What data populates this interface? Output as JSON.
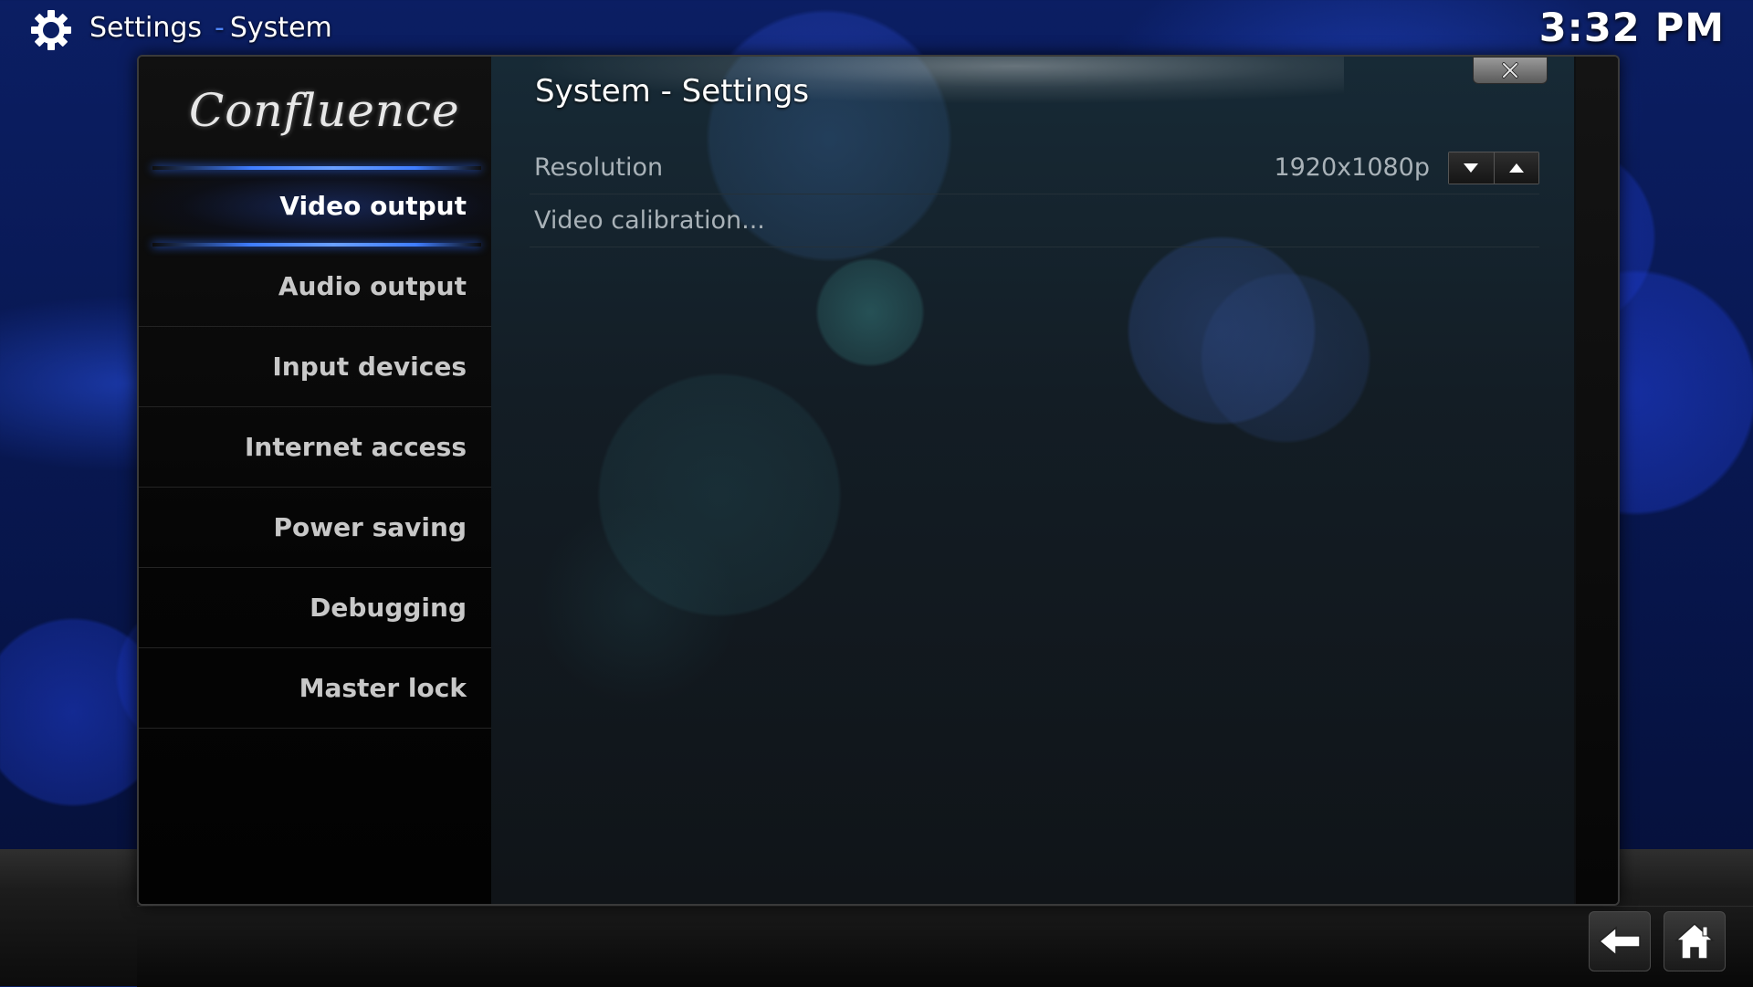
{
  "top_bar": {
    "section": "Settings",
    "separator": "-",
    "subsection": "System",
    "time": "3:32 PM",
    "icon": "gear-icon"
  },
  "sidebar": {
    "logo": "Confluence",
    "items": [
      {
        "label": "Video output",
        "active": true
      },
      {
        "label": "Audio output",
        "active": false
      },
      {
        "label": "Input devices",
        "active": false
      },
      {
        "label": "Internet access",
        "active": false
      },
      {
        "label": "Power saving",
        "active": false
      },
      {
        "label": "Debugging",
        "active": false
      },
      {
        "label": "Master lock",
        "active": false
      }
    ]
  },
  "dialog": {
    "title": "System - Settings",
    "close_icon": "close-icon"
  },
  "settings": [
    {
      "label": "Resolution",
      "value": "1920x1080p"
    },
    {
      "label": "Video calibration...",
      "value": ""
    }
  ],
  "footer": {
    "back_icon": "back-arrow-icon",
    "home_icon": "home-icon"
  },
  "colors": {
    "accent": "#3f7dff",
    "background": "#0b1e63"
  }
}
